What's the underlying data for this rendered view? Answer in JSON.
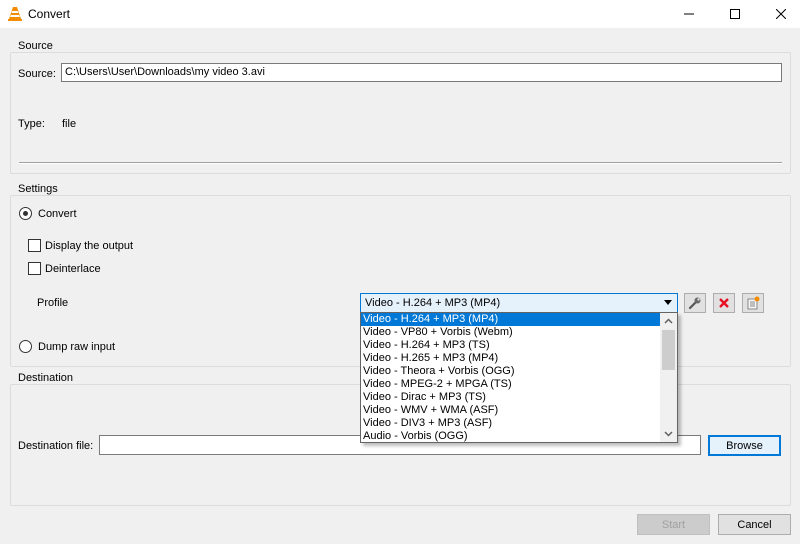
{
  "window": {
    "title": "Convert",
    "controls": {
      "minimize": "minimize-icon",
      "maximize": "maximize-icon",
      "close": "close-icon"
    }
  },
  "source": {
    "group_title": "Source",
    "source_label": "Source:",
    "source_value": "C:\\Users\\User\\Downloads\\my video 3.avi",
    "type_label": "Type:",
    "type_value": "file"
  },
  "settings": {
    "group_title": "Settings",
    "convert_label": "Convert",
    "convert_selected": true,
    "display_output_label": "Display the output",
    "display_output_checked": false,
    "deinterlace_label": "Deinterlace",
    "deinterlace_checked": false,
    "profile_label": "Profile",
    "profile_selected": "Video - H.264 + MP3 (MP4)",
    "profile_options": [
      "Video - H.264 + MP3 (MP4)",
      "Video - VP80 + Vorbis (Webm)",
      "Video - H.264 + MP3 (TS)",
      "Video - H.265 + MP3 (MP4)",
      "Video - Theora + Vorbis (OGG)",
      "Video - MPEG-2 + MPGA (TS)",
      "Video - Dirac + MP3 (TS)",
      "Video - WMV + WMA (ASF)",
      "Video - DIV3 + MP3 (ASF)",
      "Audio - Vorbis (OGG)"
    ],
    "profile_tools": {
      "edit": "wrench-icon",
      "delete": "delete-x-icon",
      "new": "new-profile-icon"
    },
    "dump_raw_label": "Dump raw input",
    "dump_raw_selected": false
  },
  "destination": {
    "group_title": "Destination",
    "file_label": "Destination file:",
    "file_value": "",
    "browse_label": "Browse"
  },
  "footer": {
    "start_label": "Start",
    "cancel_label": "Cancel"
  },
  "colors": {
    "accent": "#0078d7",
    "delete_red": "#e81123",
    "vlc_orange": "#f28c00"
  }
}
